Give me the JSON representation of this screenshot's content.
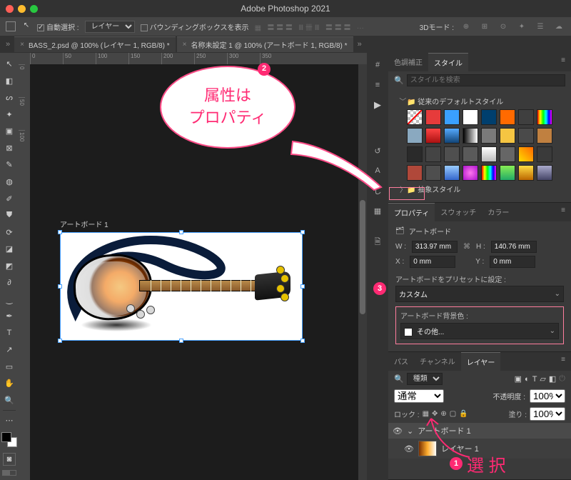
{
  "app": {
    "title": "Adobe Photoshop 2021"
  },
  "options_bar": {
    "auto_select_label": "自動選択 :",
    "auto_select_target": "レイヤー",
    "bounding_label": "バウンディングボックスを表示",
    "threeD_label": "3Dモード :"
  },
  "file_tabs": [
    {
      "label": "BASS_2.psd @ 100% (レイヤー 1, RGB/8) *"
    },
    {
      "label": "名称未設定 1 @ 100% (アートボード 1, RGB/8) *"
    }
  ],
  "ruler_h": [
    "0",
    "50",
    "100",
    "150",
    "200",
    "250",
    "300",
    "350"
  ],
  "ruler_v": [
    "0",
    "50",
    "100"
  ],
  "canvas": {
    "artboard_label": "アートボード 1"
  },
  "panel_tabs": {
    "styles_group": {
      "color_correction": "色調補正",
      "styles": "スタイル"
    },
    "search_placeholder": "スタイルを検索",
    "default_styles_folder": "従来のデフォルトスタイル",
    "abstract_styles_folder": "抽象スタイル"
  },
  "style_swatches": [
    "transparent",
    "#e63b3b",
    "#3aa0ff",
    "#ffffff",
    "#003f6e",
    "#ff6a00",
    "#3f3f3f",
    "linear-gradient(90deg,#f00,#ff0,#0f0,#0ff,#00f,#f0f)",
    "#8aa9c0",
    "linear-gradient(#f44,#a11)",
    "linear-gradient(#5af,#147)",
    "linear-gradient(90deg,#000,#fff)",
    "#7a7a7a",
    "#f5c542",
    "#4a4a4a",
    "#c08040",
    "#2a2a2a",
    "#444",
    "#4f4f4f",
    "#5a5a5a",
    "linear-gradient(#fff,#bbb)",
    "#666",
    "linear-gradient(45deg,#fd0,#f60)",
    "#3a3a3a",
    "#b0483a",
    "#4e4e4e",
    "linear-gradient(#9cf,#36c)",
    "radial-gradient(#f7e,#a1c)",
    "linear-gradient(90deg,#f00,#ff0,#0f0,#0ff,#00f,#f0f)",
    "linear-gradient(#8e5,#2a6)",
    "linear-gradient(#fd4,#b60)",
    "linear-gradient(#aac,#446)"
  ],
  "properties": {
    "tabs": {
      "properties": "プロパティ",
      "swatches": "スウォッチ",
      "color": "カラー"
    },
    "artboard_label": "アートボード",
    "w_label": "W :",
    "w_value": "313.97 mm",
    "h_label": "H :",
    "h_value": "140.76 mm",
    "x_label": "X :",
    "x_value": "0 mm",
    "y_label": "Y :",
    "y_value": "0 mm",
    "preset_label": "アートボードをプリセットに設定 :",
    "preset_value": "カスタム",
    "bg_label": "アートボード背景色 :",
    "bg_value": "その他..."
  },
  "layers_panel": {
    "tabs": {
      "paths": "パス",
      "channels": "チャンネル",
      "layers": "レイヤー"
    },
    "filter_kind": "種類",
    "blend_mode": "通常",
    "opacity_label": "不透明度 :",
    "opacity_value": "100%",
    "lock_label": "ロック :",
    "fill_label": "塗り :",
    "fill_value": "100%",
    "entries": [
      {
        "name": "アートボード 1",
        "type": "artboard"
      },
      {
        "name": "レイヤー 1",
        "type": "layer"
      }
    ]
  },
  "annotations": {
    "bubble_text": "属性は\nプロパティ",
    "num1": "1",
    "num2": "2",
    "num3": "3",
    "select_text": "選 択"
  },
  "icons": {
    "hash": "#",
    "bars": "≡",
    "play": "▶",
    "history": "↺",
    "paragraph": "A",
    "ruler": "し",
    "swatch": "▦",
    "page": "🗎"
  }
}
